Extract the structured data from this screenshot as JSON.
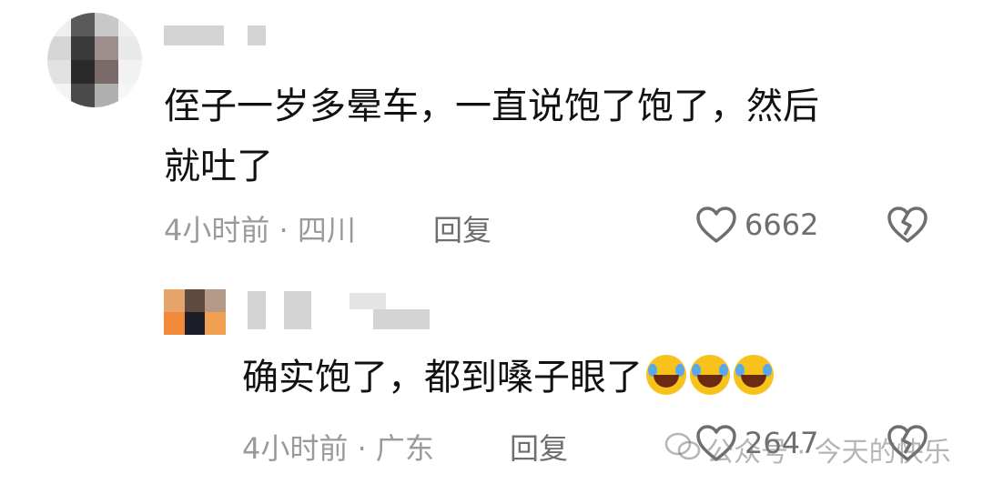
{
  "comments": [
    {
      "text_line1": "侄子一岁多晕车，一直说饱了饱了，然后",
      "text_line2": "就吐了",
      "time_location": "4小时前 · 四川",
      "reply_label": "回复",
      "like_count": "6662"
    },
    {
      "text": "确实饱了，都到嗓子眼了",
      "emoji_count": 3,
      "time_location": "4小时前 · 广东",
      "reply_label": "回复",
      "like_count": "2647"
    }
  ],
  "watermark": {
    "text": "公众号 · 今天的快乐",
    "icon": "wechat-icon"
  },
  "icons": {
    "like": "heart-outline-icon",
    "dislike": "broken-heart-icon"
  },
  "colors": {
    "meta_text": "#9a9a9a",
    "body_text": "#111111",
    "emoji": "#f8c21c"
  }
}
